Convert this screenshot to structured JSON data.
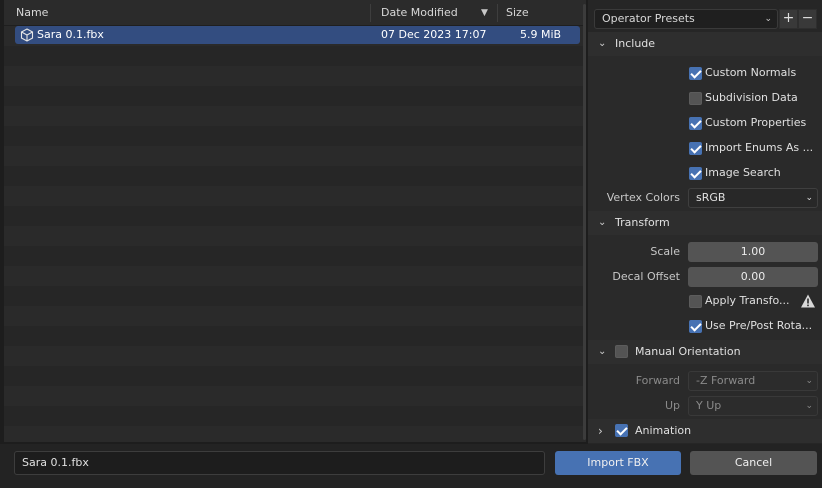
{
  "file_list": {
    "columns": {
      "name": "Name",
      "date": "Date Modified",
      "size": "Size"
    },
    "files": [
      {
        "name": "Sara 0.1.fbx",
        "date": "07 Dec 2023 17:07",
        "size": "5.9 MiB",
        "selected": true
      }
    ]
  },
  "presets": {
    "label": "Operator Presets",
    "add": "+",
    "remove": "−"
  },
  "include": {
    "title": "Include",
    "options": [
      {
        "label": "Custom Normals",
        "checked": true
      },
      {
        "label": "Subdivision Data",
        "checked": false
      },
      {
        "label": "Custom Properties",
        "checked": true
      },
      {
        "label": "Import Enums As ...",
        "checked": true
      },
      {
        "label": "Image Search",
        "checked": true
      }
    ],
    "vertex_colors": {
      "label": "Vertex Colors",
      "value": "sRGB"
    }
  },
  "transform": {
    "title": "Transform",
    "scale": {
      "label": "Scale",
      "value": "1.00"
    },
    "decal_offset": {
      "label": "Decal Offset",
      "value": "0.00"
    },
    "apply_transform": {
      "label": "Apply Transfo...",
      "checked": false
    },
    "use_pre_post": {
      "label": "Use Pre/Post Rota...",
      "checked": true
    }
  },
  "manual_orientation": {
    "title": "Manual Orientation",
    "checked": false,
    "forward": {
      "label": "Forward",
      "value": "-Z Forward"
    },
    "up": {
      "label": "Up",
      "value": "Y Up"
    }
  },
  "animation": {
    "title": "Animation",
    "checked": true
  },
  "bottom": {
    "filename": "Sara 0.1.fbx",
    "import_label": "Import FBX",
    "cancel_label": "Cancel"
  },
  "colors": {
    "accent": "#4772b3",
    "selection": "#334d80"
  }
}
